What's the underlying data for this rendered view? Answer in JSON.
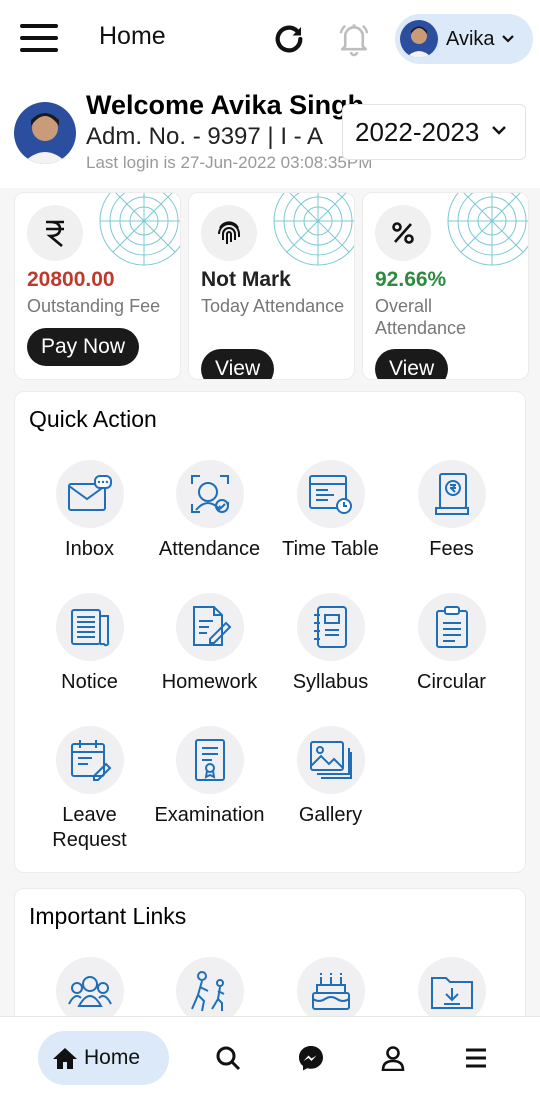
{
  "header": {
    "title": "Home",
    "user_name": "Avika",
    "icons": {
      "menu": "hamburger-icon",
      "refresh": "refresh-icon",
      "notifications": "bell-icon"
    }
  },
  "welcome": {
    "name": "Welcome Avika Singh",
    "admission": "Adm. No. - 9397 | I - A",
    "last_login": "Last login is 27-Jun-2022 03:08:35PM",
    "session": "2022-2023"
  },
  "cards": [
    {
      "icon": "rupee-icon",
      "value": "20800.00",
      "value_color": "#c0392b",
      "label": "Outstanding Fee",
      "button": "Pay Now"
    },
    {
      "icon": "fingerprint-icon",
      "value": "Not Mark",
      "value_color": "#222222",
      "label": "Today Attendance",
      "button": "View"
    },
    {
      "icon": "percent-icon",
      "value": "92.66%",
      "value_color": "#2e8b3e",
      "label": "Overall Attendance",
      "button": "View"
    }
  ],
  "quick_action": {
    "title": "Quick Action",
    "items": [
      {
        "label": "Inbox",
        "icon": "inbox-icon"
      },
      {
        "label": "Attendance",
        "icon": "attendance-icon"
      },
      {
        "label": "Time Table",
        "icon": "timetable-icon"
      },
      {
        "label": "Fees",
        "icon": "fees-icon"
      },
      {
        "label": "Notice",
        "icon": "notice-icon"
      },
      {
        "label": "Homework",
        "icon": "homework-icon"
      },
      {
        "label": "Syllabus",
        "icon": "syllabus-icon"
      },
      {
        "label": "Circular",
        "icon": "circular-icon"
      },
      {
        "label": "Leave Request",
        "icon": "leave-request-icon"
      },
      {
        "label": "Examination",
        "icon": "examination-icon"
      },
      {
        "label": "Gallery",
        "icon": "gallery-icon"
      }
    ]
  },
  "important_links": {
    "title": "Important Links",
    "icons": [
      "group-icon",
      "hiking-icon",
      "birthday-cake-icon",
      "download-folder-icon"
    ]
  },
  "bottom_nav": {
    "home_label": "Home",
    "icons": [
      "home-icon",
      "search-icon",
      "messenger-icon",
      "profile-icon",
      "menu-icon"
    ]
  },
  "colors": {
    "accent": "#1f6fb8",
    "chip_bg": "#dbe9f9",
    "button_dark": "#1a1a1a",
    "mandala": "#4fb7c4"
  }
}
